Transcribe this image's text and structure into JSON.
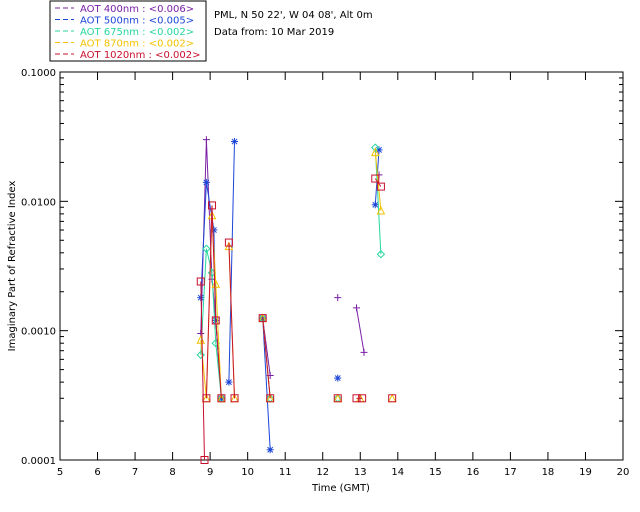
{
  "header": {
    "site_line": "PML, N 50 22', W 04 08', Alt 0m",
    "date_line": "Data from: 10 Mar 2019"
  },
  "chart_data": {
    "type": "line",
    "title": "",
    "xlabel": "Time (GMT)",
    "ylabel": "Imaginary Part of Refractive Index",
    "xlim": [
      5,
      20
    ],
    "ylim": [
      0.0001,
      0.1
    ],
    "yscale": "log",
    "x_ticks": [
      "5",
      "6",
      "7",
      "8",
      "9",
      "10",
      "11",
      "12",
      "13",
      "14",
      "15",
      "16",
      "17",
      "18",
      "19",
      "20"
    ],
    "y_ticks": [
      "0.1000",
      "0.0100",
      "0.0010",
      "0.0001"
    ],
    "grid": false,
    "legend_position": "top-left, outside plot",
    "legend": [
      {
        "label": "AOT  400nm : <0.006>",
        "color": "#7a1fa6"
      },
      {
        "label": "AOT  500nm : <0.005>",
        "color": "#1c46d8"
      },
      {
        "label": "AOT  675nm : <0.002>",
        "color": "#27d6a0"
      },
      {
        "label": "AOT  870nm : <0.002>",
        "color": "#f2c200"
      },
      {
        "label": "AOT 1020nm : <0.002>",
        "color": "#c8102e"
      }
    ],
    "series": [
      {
        "name": "AOT 400nm",
        "color": "#7a1fa6",
        "marker": "plus",
        "segments": [
          [
            [
              8.75,
              0.00095
            ],
            [
              8.9,
              0.03
            ],
            [
              9.05,
              0.0025
            ],
            [
              9.15,
              0.0012
            ],
            [
              9.3,
              0.0003
            ]
          ],
          [
            [
              10.4,
              0.00125
            ],
            [
              10.6,
              0.00045
            ]
          ],
          [
            [
              12.4,
              0.0018
            ]
          ],
          [
            [
              12.9,
              0.0015
            ],
            [
              13.1,
              0.00068
            ]
          ],
          [
            [
              13.5,
              0.016
            ]
          ]
        ]
      },
      {
        "name": "AOT 500nm",
        "color": "#1c46d8",
        "marker": "asterisk",
        "segments": [
          [
            [
              8.75,
              0.0018
            ],
            [
              8.9,
              0.014
            ],
            [
              9.1,
              0.006
            ],
            [
              9.15,
              0.0012
            ],
            [
              9.3,
              0.0003
            ]
          ],
          [
            [
              9.5,
              0.0004
            ],
            [
              9.65,
              0.029
            ]
          ],
          [
            [
              10.4,
              0.00125
            ],
            [
              10.6,
              0.00012
            ]
          ],
          [
            [
              12.4,
              0.00043
            ]
          ],
          [
            [
              13.4,
              0.0094
            ],
            [
              13.5,
              0.025
            ]
          ]
        ]
      },
      {
        "name": "AOT 675nm",
        "color": "#27d6a0",
        "marker": "diamond",
        "segments": [
          [
            [
              8.75,
              0.00065
            ],
            [
              8.9,
              0.0043
            ],
            [
              9.05,
              0.0028
            ],
            [
              9.15,
              0.0008
            ],
            [
              9.3,
              0.0003
            ]
          ],
          [
            [
              10.4,
              0.00125
            ],
            [
              10.6,
              0.0003
            ]
          ],
          [
            [
              12.4,
              0.0003
            ]
          ],
          [
            [
              13.4,
              0.026
            ],
            [
              13.55,
              0.0039
            ]
          ]
        ]
      },
      {
        "name": "AOT 870nm",
        "color": "#f2c200",
        "marker": "triangle",
        "segments": [
          [
            [
              8.75,
              0.00085
            ],
            [
              8.9,
              0.0003
            ],
            [
              9.05,
              0.0078
            ],
            [
              9.15,
              0.0023
            ],
            [
              9.3,
              0.0003
            ]
          ],
          [
            [
              9.5,
              0.0045
            ],
            [
              9.65,
              0.0003
            ]
          ],
          [
            [
              10.4,
              0.00125
            ],
            [
              10.6,
              0.0003
            ]
          ],
          [
            [
              12.4,
              0.0003
            ]
          ],
          [
            [
              13.0,
              0.0003
            ]
          ],
          [
            [
              13.4,
              0.024
            ],
            [
              13.55,
              0.0085
            ]
          ],
          [
            [
              13.85,
              0.0003
            ]
          ]
        ]
      },
      {
        "name": "AOT 1020nm",
        "color": "#c8102e",
        "marker": "square",
        "segments": [
          [
            [
              8.75,
              0.0024
            ],
            [
              8.85,
              0.0001
            ]
          ],
          [
            [
              8.9,
              0.0003
            ],
            [
              9.05,
              0.0093
            ],
            [
              9.15,
              0.0012
            ],
            [
              9.3,
              0.0003
            ]
          ],
          [
            [
              9.5,
              0.0048
            ],
            [
              9.65,
              0.0003
            ]
          ],
          [
            [
              10.4,
              0.00125
            ],
            [
              10.6,
              0.0003
            ]
          ],
          [
            [
              12.4,
              0.0003
            ]
          ],
          [
            [
              12.9,
              0.0003
            ],
            [
              13.05,
              0.0003
            ]
          ],
          [
            [
              13.4,
              0.015
            ],
            [
              13.55,
              0.013
            ]
          ],
          [
            [
              13.85,
              0.0003
            ]
          ]
        ]
      }
    ]
  }
}
